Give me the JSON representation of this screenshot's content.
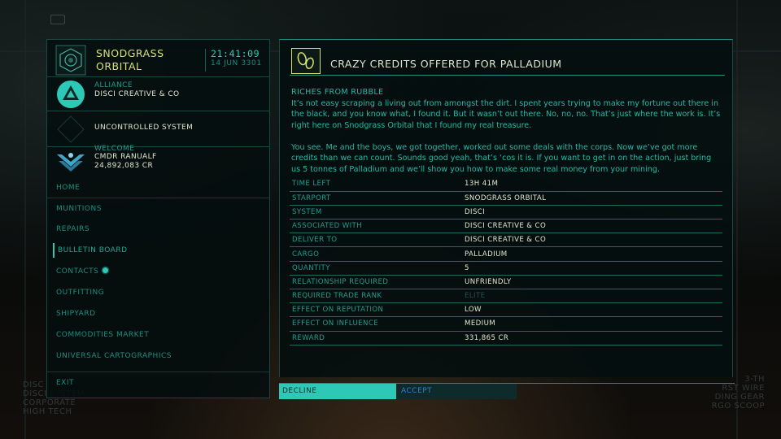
{
  "station": {
    "name_line1": "SNODGRASS",
    "name_line2": "ORBITAL",
    "time": "21:41:09",
    "date": "14 JUN 3301"
  },
  "faction": {
    "label": "ALLIANCE",
    "value": "DISCI CREATIVE & CO"
  },
  "system_status": {
    "value": "UNCONTROLLED SYSTEM"
  },
  "commander": {
    "label": "WELCOME",
    "name": "CMDR RANUALF",
    "credits": "24,892,083 CR"
  },
  "nav": {
    "items": [
      {
        "label": "HOME"
      },
      {
        "label": "MUNITIONS"
      },
      {
        "label": "REPAIRS"
      },
      {
        "label": "BULLETIN BOARD",
        "active": true
      },
      {
        "label": "CONTACTS"
      },
      {
        "label": "OUTFITTING"
      },
      {
        "label": "SHIPYARD"
      },
      {
        "label": "COMMODITIES MARKET"
      },
      {
        "label": "UNIVERSAL CARTOGRAPHICS"
      }
    ],
    "exit_label": "EXIT"
  },
  "background_text": {
    "left": [
      "DISC",
      "DISCI SYSTEM",
      "CORPORATE",
      "HIGH TECH"
    ],
    "right": [
      "3-TH",
      "RST WIRE",
      "DING GEAR",
      "RGO SCOOP"
    ]
  },
  "mission": {
    "title": "CRAZY CREDITS OFFERED FOR PALLADIUM",
    "subheading": "RICHES FROM RUBBLE",
    "paragraph1": "It’s not easy scraping a living out from amongst the dirt. I spent years trying to make my fortune out there in the black, and you know what, I found it. But it wasn’t out there. No, no, no. That’s just where the work is. It’s right here on Snodgrass Orbital that I found my real treasure.",
    "paragraph2": "You see. Me and the boys, we got together, worked out some deals with the corps. Now we’ve got more credits than we can count. Sounds good yeah, that’s ‘cos it is. If you want to get in on the action, just bring us 5 tonnes of Palladium and we’ll show you how to make some real money from your mining.",
    "details": [
      {
        "key": "TIME LEFT",
        "value": "13H 41M"
      },
      {
        "key": "STARPORT",
        "value": "SNODGRASS ORBITAL"
      },
      {
        "key": "SYSTEM",
        "value": "DISCI"
      },
      {
        "key": "ASSOCIATED WITH",
        "value": "DISCI CREATIVE & CO"
      },
      {
        "key": "DELIVER TO",
        "value": "DISCI CREATIVE & CO"
      },
      {
        "key": "CARGO",
        "value": "PALLADIUM"
      },
      {
        "key": "QUANTITY",
        "value": "5"
      },
      {
        "key": "RELATIONSHIP REQUIRED",
        "value": "UNFRIENDLY"
      },
      {
        "key": "REQUIRED TRADE RANK",
        "value": "ELITE",
        "dim": true
      },
      {
        "key": "EFFECT ON REPUTATION",
        "value": "LOW"
      },
      {
        "key": "EFFECT ON INFLUENCE",
        "value": "MEDIUM"
      },
      {
        "key": "REWARD",
        "value": "331,865 CR"
      }
    ]
  },
  "actions": {
    "decline": "DECLINE",
    "accept": "ACCEPT"
  },
  "colors": {
    "accent": "#2ec9b6",
    "highlight": "#d8e070",
    "text_bright": "#e2e6d0",
    "accept_blue": "#2f7fcf"
  }
}
